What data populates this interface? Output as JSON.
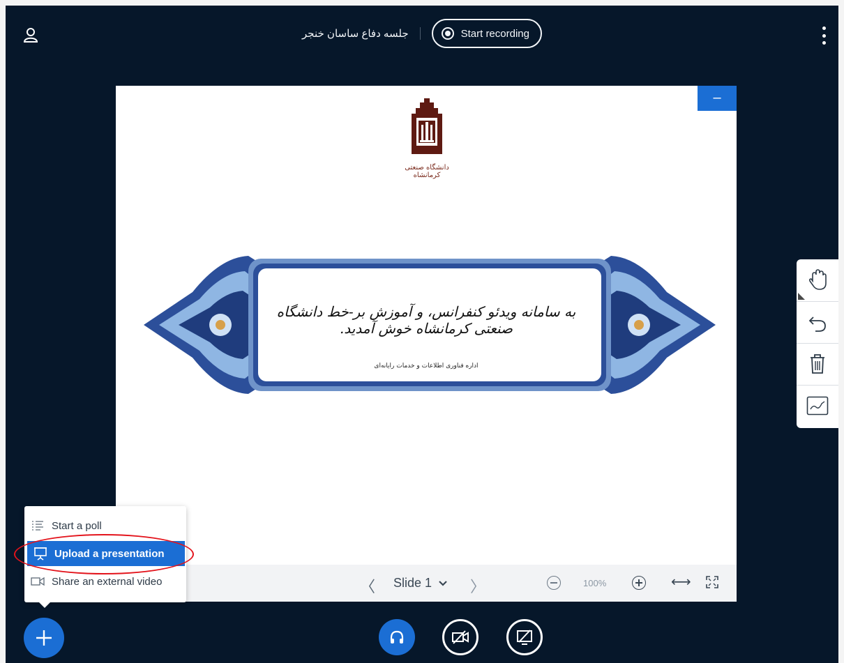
{
  "header": {
    "meeting_title": "جلسه دفاع ساسان خنجر",
    "record_label": "Start recording"
  },
  "slide": {
    "minimize_label": "–",
    "logo_caption": "دانشگاه صنعتی کرمانشاه",
    "welcome_text": "به سامانه ویدئو کنفرانس، و آموزش بر-خط دانشگاه صنعتی کرمانشاه خوش آمدید.",
    "department_text": "اداره فناوری اطلاعات و خدمات رایانه‌ای"
  },
  "slide_toolbar": {
    "prev_symbol": "〈",
    "slide_label": "Slide 1",
    "next_symbol": "〉",
    "zoom_level": "100%",
    "fit_symbol": "⟷"
  },
  "action_menu": {
    "items": [
      {
        "label": "Start a poll",
        "icon": "poll-icon"
      },
      {
        "label": "Upload a presentation",
        "icon": "presentation-icon",
        "active": true
      },
      {
        "label": "Share an external video",
        "icon": "video-icon"
      }
    ]
  },
  "colors": {
    "background": "#06172a",
    "accent": "#1b6ed4",
    "highlight": "#e3131b"
  }
}
